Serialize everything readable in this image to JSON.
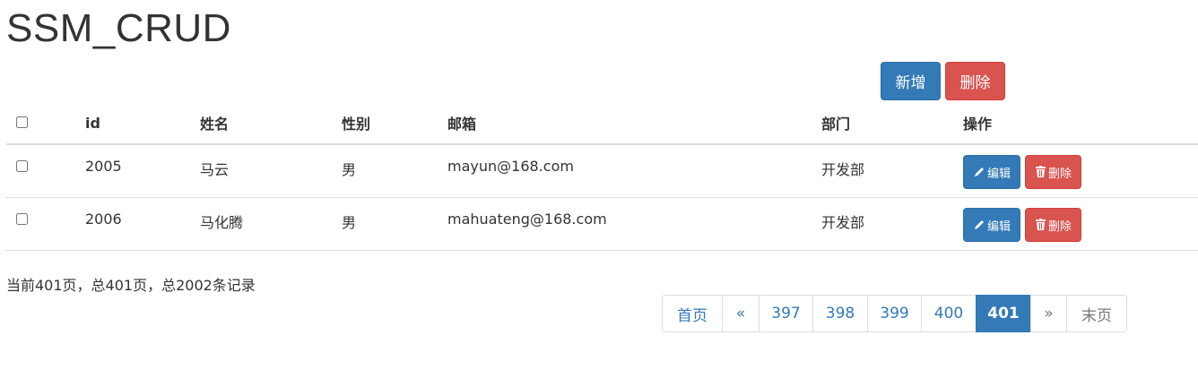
{
  "page": {
    "title": "SSM_CRUD"
  },
  "toolbar": {
    "add_label": "新增",
    "delete_label": "删除"
  },
  "table": {
    "headers": [
      "id",
      "姓名",
      "性别",
      "邮箱",
      "部门",
      "操作"
    ],
    "rows": [
      {
        "id": "2005",
        "name": "马云",
        "gender": "男",
        "email": "mayun@168.com",
        "dept": "开发部"
      },
      {
        "id": "2006",
        "name": "马化腾",
        "gender": "男",
        "email": "mahuateng@168.com",
        "dept": "开发部"
      }
    ],
    "edit_label": "编辑",
    "delete_label": "删除"
  },
  "pagination": {
    "info": "当前401页，总401页，总2002条记录",
    "first": "首页",
    "prev": "«",
    "pages": [
      "397",
      "398",
      "399",
      "400",
      "401"
    ],
    "current": "401",
    "next": "»",
    "last": "末页"
  },
  "colors": {
    "primary": "#337ab7",
    "danger": "#d9534f",
    "border": "#dddddd"
  },
  "icons": {
    "edit": "pencil-icon",
    "delete": "trash-icon"
  }
}
